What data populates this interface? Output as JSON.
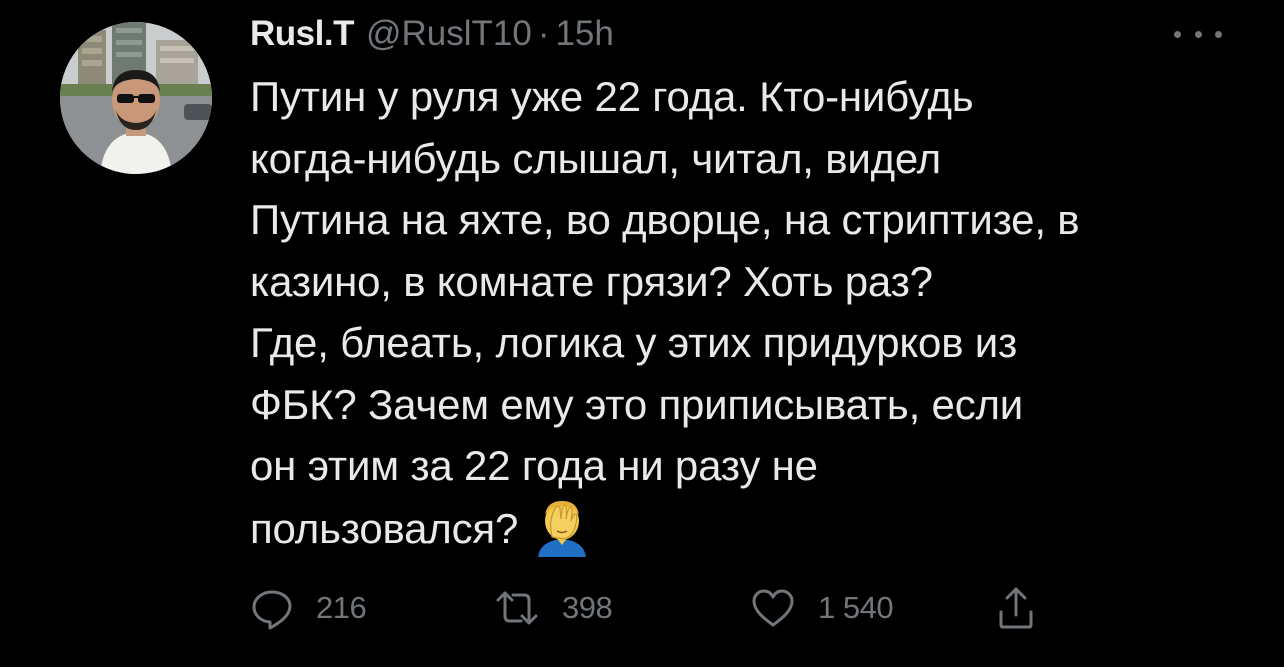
{
  "tweet": {
    "author": {
      "name": "Rusl.T",
      "handle": "@RuslT10",
      "separator": "·",
      "timestamp": "15h"
    },
    "text_lines": [
      "Путин у руля уже 22 года. Кто-нибудь",
      "когда-нибудь слышал, читал, видел",
      "Путина на яхте, во дворце, на стриптизе, в",
      "казино, в комнате грязи? Хоть раз?",
      "Где, блеать, логика у этих придурков из",
      "ФБК? Зачем ему это приписывать, если",
      "он этим за 22 года ни разу не",
      "пользовался?"
    ],
    "emoji": "facepalm-emoji",
    "actions": {
      "reply_count": "216",
      "retweet_count": "398",
      "like_count": "1 540"
    }
  },
  "icons": {
    "more": "more-dots-icon",
    "reply": "reply-icon",
    "retweet": "retweet-icon",
    "like": "heart-icon",
    "share": "share-icon"
  },
  "colors": {
    "background": "#000000",
    "text": "#e7e9ea",
    "secondary": "#71767b"
  }
}
